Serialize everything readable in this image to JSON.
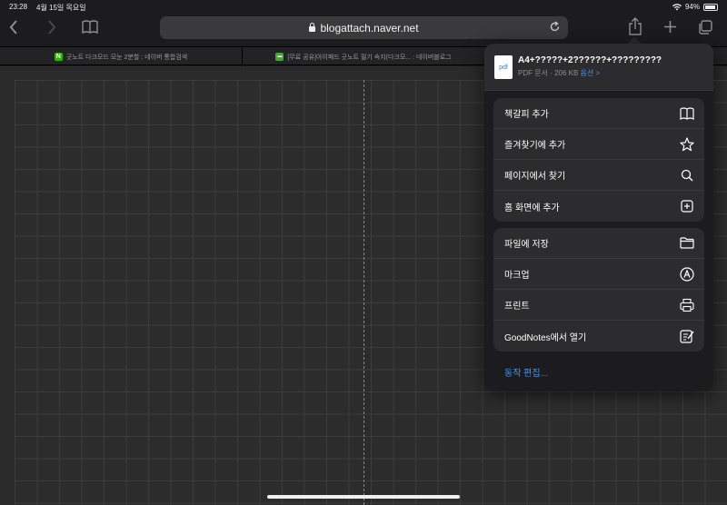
{
  "status_bar": {
    "time": "23:28",
    "date": "4월 15일 목요일",
    "battery": "94%",
    "battery_level": 0.94
  },
  "toolbar": {
    "url": "blogattach.naver.net",
    "back_icon": "chevron-left-icon",
    "forward_icon": "chevron-right-icon",
    "bookmarks_icon": "book-icon",
    "reload_icon": "reload-icon",
    "share_icon": "share-icon",
    "new_tab_icon": "plus-icon",
    "tabs_icon": "tabs-icon"
  },
  "tabs": [
    {
      "title": "굿노트 다크모드 모눈 2분할 : 네이버 통합검색",
      "favicon": "N",
      "favicon_color": "#2db400"
    },
    {
      "title": "[무료 공유]아이패드 굿노트 필기 속지(다크모... : 네이버블로그",
      "favicon": "▬",
      "favicon_color": "#44a833"
    }
  ],
  "share_sheet": {
    "file_name": "A4+?????+2??????+?????????",
    "file_meta": "PDF 문서 · 206 KB",
    "options_label": "옵션 >",
    "file_icon_label": "pdf",
    "groups": [
      [
        {
          "label": "책갈피 추가",
          "icon": "book-icon"
        },
        {
          "label": "즐겨찾기에 추가",
          "icon": "star-icon"
        },
        {
          "label": "페이지에서 찾기",
          "icon": "search-icon"
        },
        {
          "label": "홈 화면에 추가",
          "icon": "add-square-icon"
        }
      ],
      [
        {
          "label": "파일에 저장",
          "icon": "folder-icon"
        },
        {
          "label": "마크업",
          "icon": "markup-icon"
        },
        {
          "label": "프린트",
          "icon": "printer-icon"
        },
        {
          "label": "GoodNotes에서 열기",
          "icon": "note-edit-icon"
        }
      ]
    ],
    "edit_actions": "동작 편집..."
  }
}
